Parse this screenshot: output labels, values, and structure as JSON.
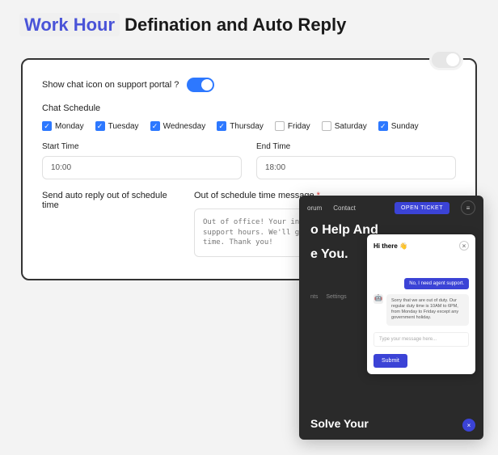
{
  "title": {
    "highlight": "Work Hour",
    "rest": " Defination and Auto Reply"
  },
  "settings": {
    "show_chat_label": "Show chat icon on support portal ?",
    "show_chat_on": true,
    "schedule_label": "Chat Schedule",
    "days": [
      {
        "label": "Monday",
        "checked": true
      },
      {
        "label": "Tuesday",
        "checked": true
      },
      {
        "label": "Wednesday",
        "checked": true
      },
      {
        "label": "Thursday",
        "checked": true
      },
      {
        "label": "Friday",
        "checked": false
      },
      {
        "label": "Saturday",
        "checked": false
      },
      {
        "label": "Sunday",
        "checked": true
      }
    ],
    "start_label": "Start Time",
    "start_value": "10:00",
    "end_label": "End Time",
    "end_value": "18:00",
    "auto_reply_label": "Send auto reply out of schedule time",
    "auto_reply_on": true,
    "message_label": "Out of schedule time message",
    "required_mark": "*",
    "message_value": "Out of office! Your inquiry received outside our support hours. We'll get back during our next available time. Thank you!"
  },
  "preview": {
    "nav": {
      "forum": "orum",
      "contact": "Contact"
    },
    "open_ticket": "OPEN TICKET",
    "hero1": "o Help And",
    "hero2": "e You.",
    "tabs": {
      "a": "nts",
      "b": "Settings"
    },
    "solve": "Solve Your"
  },
  "chat": {
    "greeting": "Hi there",
    "wave": "👋",
    "agent_pill": "No, I need agent support.",
    "bot_reply": "Sorry that we are out of duty. Our regular duty time is 10AM to 6PM, from Monday to Friday except any government holiday.",
    "input_placeholder": "Type your message here...",
    "submit": "Submit",
    "fab_glyph": "×"
  },
  "colors": {
    "accent": "#3b43d6",
    "toggle": "#2d78ff"
  }
}
